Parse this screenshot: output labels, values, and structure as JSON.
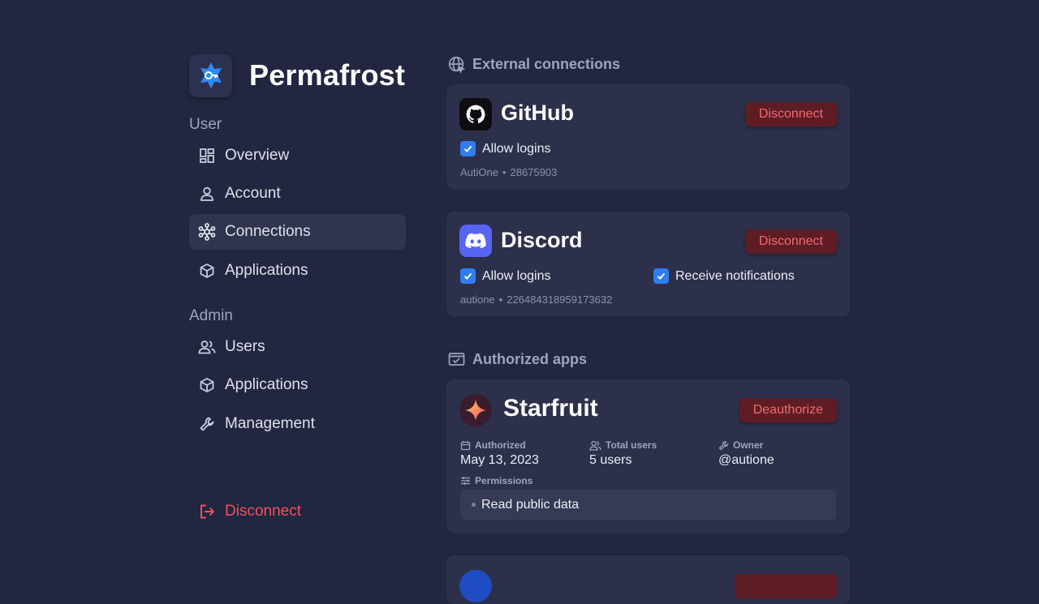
{
  "app": {
    "name": "Permafrost"
  },
  "sidebar": {
    "user_section": "User",
    "admin_section": "Admin",
    "user_items": [
      {
        "label": "Overview",
        "icon": "dashboard-icon"
      },
      {
        "label": "Account",
        "icon": "person-icon"
      },
      {
        "label": "Connections",
        "icon": "connections-icon",
        "active": true
      },
      {
        "label": "Applications",
        "icon": "cube-icon"
      }
    ],
    "admin_items": [
      {
        "label": "Users",
        "icon": "users-icon"
      },
      {
        "label": "Applications",
        "icon": "cube-icon"
      },
      {
        "label": "Management",
        "icon": "wrench-icon"
      }
    ],
    "logout_label": "Disconnect"
  },
  "external": {
    "heading": "External connections",
    "github": {
      "name": "GitHub",
      "button": "Disconnect",
      "allow_logins": "Allow logins",
      "username": "AutiOne",
      "separator": "•",
      "id": "28675903"
    },
    "discord": {
      "name": "Discord",
      "button": "Disconnect",
      "allow_logins": "Allow logins",
      "receive_notifications": "Receive notifications",
      "username": "autione",
      "separator": "•",
      "id": "226484318959173632"
    }
  },
  "authorized": {
    "heading": "Authorized apps",
    "starfruit": {
      "name": "Starfruit",
      "button": "Deauthorize",
      "authorized_label": "Authorized",
      "authorized_value": "May 13, 2023",
      "users_label": "Total users",
      "users_value": "5 users",
      "owner_label": "Owner",
      "owner_value": "@autione",
      "permissions_label": "Permissions",
      "permission": "Read public data"
    }
  },
  "colors": {
    "background": "#232640",
    "card": "#2c304a",
    "accent": "#2f7df0",
    "danger": "#f0525a",
    "danger_button_bg": "#5e1c24"
  }
}
